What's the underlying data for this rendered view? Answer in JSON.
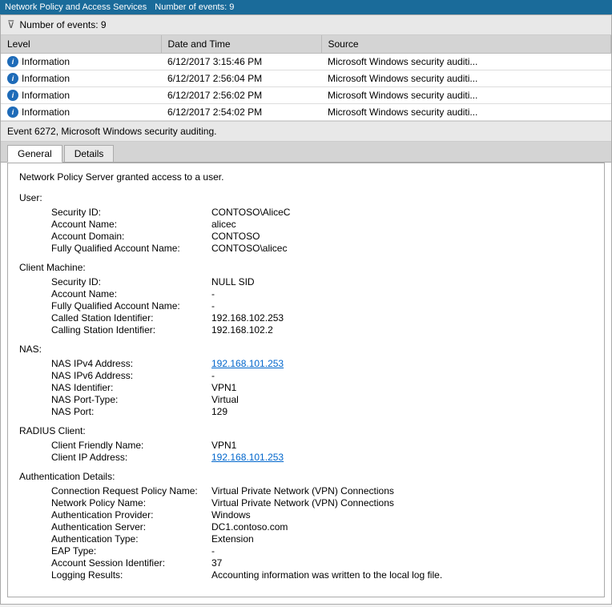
{
  "titleBar": {
    "title": "Network Policy and Access Services",
    "eventCount": "Number of events: 9"
  },
  "filterBar": {
    "label": "Number of events: 9"
  },
  "table": {
    "headers": [
      "Level",
      "Date and Time",
      "Source"
    ],
    "rows": [
      {
        "level": "Information",
        "dateTime": "6/12/2017 3:15:46 PM",
        "source": "Microsoft Windows security auditi..."
      },
      {
        "level": "Information",
        "dateTime": "6/12/2017 2:56:04 PM",
        "source": "Microsoft Windows security auditi..."
      },
      {
        "level": "Information",
        "dateTime": "6/12/2017 2:56:02 PM",
        "source": "Microsoft Windows security auditi..."
      },
      {
        "level": "Information",
        "dateTime": "6/12/2017 2:54:02 PM",
        "source": "Microsoft Windows security auditi..."
      }
    ]
  },
  "eventHeader": "Event 6272, Microsoft Windows security auditing.",
  "tabs": [
    {
      "label": "General",
      "active": true
    },
    {
      "label": "Details",
      "active": false
    }
  ],
  "detail": {
    "intro": "Network Policy Server granted access to a user.",
    "sections": [
      {
        "title": "User:",
        "rows": [
          {
            "label": "Security ID:",
            "value": "CONTOSO\\AliceC",
            "isLink": false
          },
          {
            "label": "Account Name:",
            "value": "alicec",
            "isLink": false
          },
          {
            "label": "Account Domain:",
            "value": "CONTOSO",
            "isLink": false
          },
          {
            "label": "Fully Qualified Account Name:",
            "value": "CONTOSO\\alicec",
            "isLink": false
          }
        ]
      },
      {
        "title": "Client Machine:",
        "rows": [
          {
            "label": "Security ID:",
            "value": "NULL SID",
            "isLink": false
          },
          {
            "label": "Account Name:",
            "value": "-",
            "isLink": false
          },
          {
            "label": "Fully Qualified Account Name:",
            "value": "-",
            "isLink": false
          },
          {
            "label": "Called Station Identifier:",
            "value": "192.168.102.253",
            "isLink": false
          },
          {
            "label": "Calling Station Identifier:",
            "value": "192.168.102.2",
            "isLink": false
          }
        ]
      },
      {
        "title": "NAS:",
        "rows": [
          {
            "label": "NAS IPv4 Address:",
            "value": "192.168.101.253",
            "isLink": true
          },
          {
            "label": "NAS IPv6 Address:",
            "value": "-",
            "isLink": false
          },
          {
            "label": "NAS Identifier:",
            "value": "VPN1",
            "isLink": false
          },
          {
            "label": "NAS Port-Type:",
            "value": "Virtual",
            "isLink": false
          },
          {
            "label": "NAS Port:",
            "value": "129",
            "isLink": false
          }
        ]
      },
      {
        "title": "RADIUS Client:",
        "rows": [
          {
            "label": "Client Friendly Name:",
            "value": "VPN1",
            "isLink": false
          },
          {
            "label": "Client IP Address:",
            "value": "192.168.101.253",
            "isLink": true
          }
        ]
      },
      {
        "title": "Authentication Details:",
        "rows": [
          {
            "label": "Connection Request Policy Name:",
            "value": "Virtual Private Network (VPN) Connections",
            "isLink": false
          },
          {
            "label": "Network Policy Name:",
            "value": "Virtual Private Network (VPN) Connections",
            "isLink": false
          },
          {
            "label": "Authentication Provider:",
            "value": "Windows",
            "isLink": false
          },
          {
            "label": "Authentication Server:",
            "value": "DC1.contoso.com",
            "isLink": false
          },
          {
            "label": "Authentication Type:",
            "value": "Extension",
            "isLink": false
          },
          {
            "label": "EAP Type:",
            "value": "-",
            "isLink": false
          },
          {
            "label": "Account Session Identifier:",
            "value": "37",
            "isLink": false
          },
          {
            "label": "Logging Results:",
            "value": "Accounting information was written to the local log file.",
            "isLink": false
          }
        ]
      }
    ]
  }
}
